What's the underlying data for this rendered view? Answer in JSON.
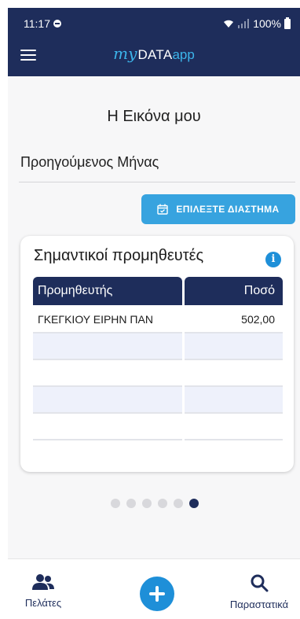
{
  "status": {
    "time": "11:17",
    "battery": "100%"
  },
  "header": {
    "logo_my": "my",
    "logo_data": "DATA",
    "logo_app": "app",
    "menu_icon": "hamburger-icon"
  },
  "page": {
    "title": "Η Εικόνα μου",
    "section": "Προηγούμενος Μήνας",
    "period_button": "ΕΠΙΛΕΞΤΕ ΔΙΑΣΤΗΜΑ"
  },
  "card": {
    "title": "Σημαντικοί προμηθευτές",
    "info_icon": "info-icon",
    "columns": [
      "Προμηθευτής",
      "Ποσό"
    ],
    "rows": [
      [
        "ΓΚΕΓΚΙΟΥ ΕΙΡΗΝ ΠΑΝ",
        "502,00"
      ],
      [
        "",
        ""
      ],
      [
        "",
        ""
      ],
      [
        "",
        ""
      ],
      [
        "",
        ""
      ]
    ]
  },
  "pager": {
    "total": 6,
    "active_index": 5
  },
  "bottom_nav": {
    "customers": "Πελάτες",
    "documents": "Παραστατικά",
    "add_icon": "plus-icon"
  },
  "colors": {
    "navy": "#1e2d5b",
    "accent": "#37a3df",
    "fab": "#1e8fd8"
  }
}
